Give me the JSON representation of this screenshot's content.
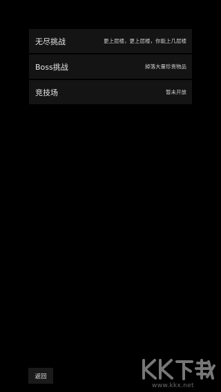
{
  "menu": {
    "items": [
      {
        "label": "无尽挑战",
        "desc": "更上层楼，更上层楼，你能上几层楼"
      },
      {
        "label": "Boss挑战",
        "desc": "掉落大量珍贵物品"
      },
      {
        "label": "竞技场",
        "desc": "暂未开放"
      }
    ]
  },
  "footer": {
    "back_label": "返回"
  },
  "watermark": {
    "logo_text": "KK下载",
    "url": "www.kkx.net",
    "color": "#d9d9d9"
  }
}
